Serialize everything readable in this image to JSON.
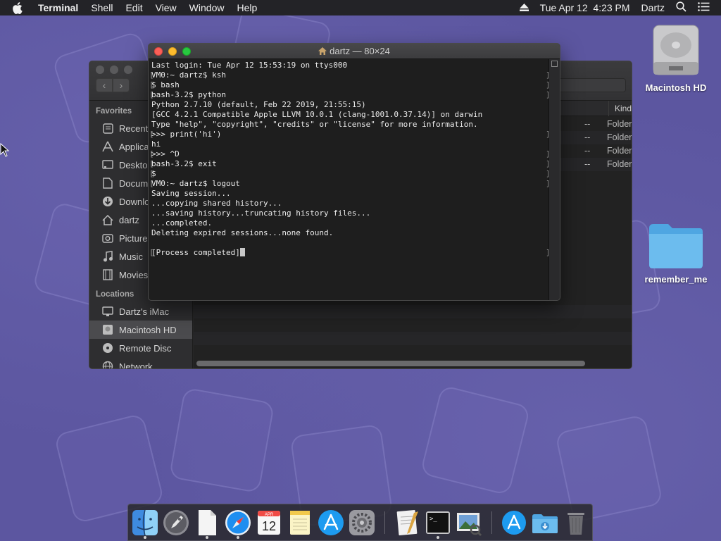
{
  "menubar": {
    "app_name": "Terminal",
    "menus": [
      "Shell",
      "Edit",
      "View",
      "Window",
      "Help"
    ],
    "datetime": "Tue Apr 12  4:23 PM",
    "user": "Dartz",
    "icons": [
      "apple-icon",
      "eject-icon",
      "spotlight-search-icon",
      "notification-center-icon"
    ]
  },
  "terminal": {
    "title": "dartz — 80×24",
    "title_icon": "home-icon",
    "lines": [
      "Last login: Tue Apr 12 15:53:19 on ttys000",
      "VM0:~ dartz$ ksh",
      "$ bash",
      "bash-3.2$ python",
      "Python 2.7.10 (default, Feb 22 2019, 21:55:15)",
      "[GCC 4.2.1 Compatible Apple LLVM 10.0.1 (clang-1001.0.37.14)] on darwin",
      "Type \"help\", \"copyright\", \"credits\" or \"license\" for more information.",
      ">>> print('hi')",
      "hi",
      ">>> ^D",
      "bash-3.2$ exit",
      "$",
      "VM0:~ dartz$ logout",
      "Saving session...",
      "...copying shared history...",
      "...saving history...truncating history files...",
      "...completed.",
      "Deleting expired sessions...none found.",
      "",
      "[Process completed]"
    ]
  },
  "finder": {
    "favorites_heading": "Favorites",
    "favorites": [
      {
        "label": "Recents",
        "icon": "recents-icon"
      },
      {
        "label": "Applications",
        "icon": "applications-icon"
      },
      {
        "label": "Desktop",
        "icon": "desktop-icon"
      },
      {
        "label": "Documents",
        "icon": "documents-icon"
      },
      {
        "label": "Downloads",
        "icon": "downloads-icon"
      },
      {
        "label": "dartz",
        "icon": "home-icon"
      },
      {
        "label": "Pictures",
        "icon": "pictures-icon"
      },
      {
        "label": "Music",
        "icon": "music-icon"
      },
      {
        "label": "Movies",
        "icon": "movies-icon"
      }
    ],
    "locations_heading": "Locations",
    "locations": [
      {
        "label": "Dartz's iMac",
        "icon": "imac-icon"
      },
      {
        "label": "Macintosh HD",
        "icon": "disk-icon"
      },
      {
        "label": "Remote Disc",
        "icon": "disc-icon"
      },
      {
        "label": "Network",
        "icon": "network-icon"
      }
    ],
    "column_kind": "Kind",
    "rows": [
      {
        "size": "--",
        "kind": "Folder"
      },
      {
        "size": "--",
        "kind": "Folder"
      },
      {
        "size": "--",
        "kind": "Folder"
      },
      {
        "size": "--",
        "kind": "Folder"
      }
    ]
  },
  "desktop": {
    "icons": [
      {
        "label": "Macintosh HD",
        "icon": "hard-drive-icon"
      },
      {
        "label": "remember_me",
        "icon": "folder-icon"
      }
    ]
  },
  "dock": {
    "apps": [
      {
        "name": "finder-icon",
        "running": true
      },
      {
        "name": "launchpad-icon",
        "running": false
      },
      {
        "name": "textedit-document-icon",
        "running": true
      },
      {
        "name": "safari-icon",
        "running": true
      },
      {
        "name": "calendar-icon",
        "running": false,
        "month": "APR",
        "day": "12"
      },
      {
        "name": "notes-icon",
        "running": false
      },
      {
        "name": "app-store-icon",
        "running": false
      },
      {
        "name": "system-preferences-icon",
        "running": false
      },
      {
        "name": "textedit-icon",
        "running": false
      },
      {
        "name": "terminal-icon",
        "running": true
      },
      {
        "name": "preview-icon",
        "running": false
      },
      {
        "name": "applications-folder-icon",
        "running": false
      },
      {
        "name": "downloads-folder-icon",
        "running": false
      },
      {
        "name": "trash-icon",
        "running": false
      }
    ]
  }
}
